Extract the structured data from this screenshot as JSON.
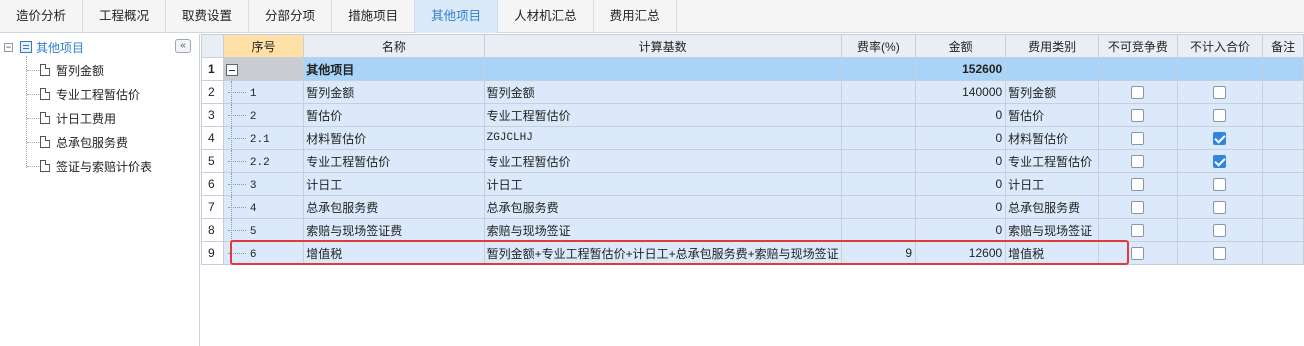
{
  "tabs": [
    {
      "label": "造价分析",
      "active": false
    },
    {
      "label": "工程概况",
      "active": false
    },
    {
      "label": "取费设置",
      "active": false
    },
    {
      "label": "分部分项",
      "active": false
    },
    {
      "label": "措施项目",
      "active": false
    },
    {
      "label": "其他项目",
      "active": true
    },
    {
      "label": "人材机汇总",
      "active": false
    },
    {
      "label": "费用汇总",
      "active": false
    }
  ],
  "sidebar": {
    "collapse_label": "«",
    "root_toggle": "⊟",
    "root_label": "其他项目",
    "items": [
      {
        "label": "暂列金额"
      },
      {
        "label": "专业工程暂估价"
      },
      {
        "label": "计日工费用"
      },
      {
        "label": "总承包服务费"
      },
      {
        "label": "签证与索赔计价表"
      }
    ]
  },
  "grid": {
    "columns": [
      "",
      "序号",
      "名称",
      "计算基数",
      "费率(%)",
      "金额",
      "费用类别",
      "不可竞争费",
      "不计入合价",
      "备注"
    ],
    "rows": [
      {
        "n": "1",
        "seq": "",
        "name": "其他项目",
        "base": "",
        "rate": "",
        "amount": "152600",
        "category": "",
        "nc": null,
        "ex": null
      },
      {
        "n": "2",
        "seq": "1",
        "name": "暂列金额",
        "base": "暂列金额",
        "rate": "",
        "amount": "140000",
        "category": "暂列金额",
        "nc": false,
        "ex": false
      },
      {
        "n": "3",
        "seq": "2",
        "name": "暂估价",
        "base": "专业工程暂估价",
        "rate": "",
        "amount": "0",
        "category": "暂估价",
        "nc": false,
        "ex": false
      },
      {
        "n": "4",
        "seq": "2.1",
        "name": "材料暂估价",
        "base": "ZGJCLHJ",
        "rate": "",
        "amount": "0",
        "category": "材料暂估价",
        "nc": false,
        "ex": true
      },
      {
        "n": "5",
        "seq": "2.2",
        "name": "专业工程暂估价",
        "base": "专业工程暂估价",
        "rate": "",
        "amount": "0",
        "category": "专业工程暂估价",
        "nc": false,
        "ex": true
      },
      {
        "n": "6",
        "seq": "3",
        "name": "计日工",
        "base": "计日工",
        "rate": "",
        "amount": "0",
        "category": "计日工",
        "nc": false,
        "ex": false
      },
      {
        "n": "7",
        "seq": "4",
        "name": "总承包服务费",
        "base": "总承包服务费",
        "rate": "",
        "amount": "0",
        "category": "总承包服务费",
        "nc": false,
        "ex": false
      },
      {
        "n": "8",
        "seq": "5",
        "name": "索赔与现场签证费",
        "base": "索赔与现场签证",
        "rate": "",
        "amount": "0",
        "category": "索赔与现场签证",
        "nc": false,
        "ex": false
      },
      {
        "n": "9",
        "seq": "6",
        "name": "增值税",
        "base": "暂列金额+专业工程暂估价+计日工+总承包服务费+索赔与现场签证",
        "rate": "9",
        "amount": "12600",
        "category": "增值税",
        "nc": false,
        "ex": false
      }
    ]
  },
  "colors": {
    "accent": "#2f7fd1",
    "row_bg": "#dbe9fa",
    "selected_row": "#a9d3f7",
    "header_seq": "#ffe0a6",
    "highlight_border": "#e23a3a"
  }
}
